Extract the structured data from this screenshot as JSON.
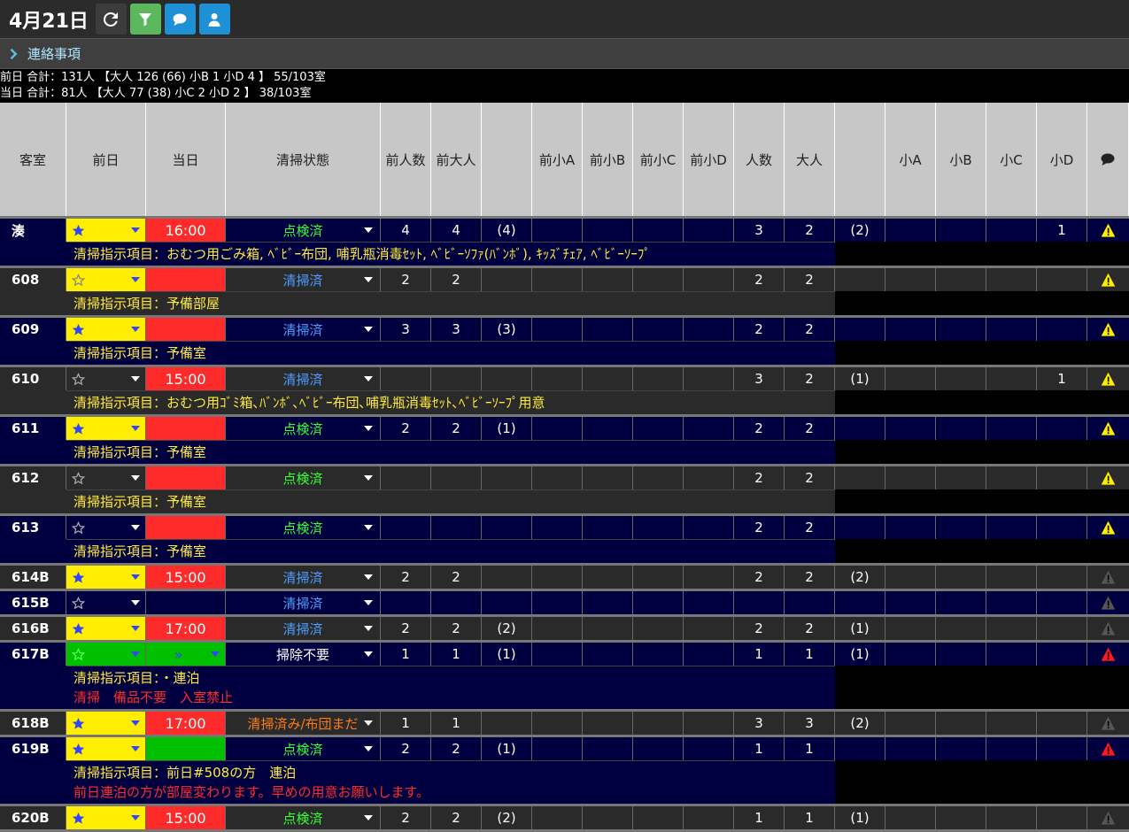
{
  "header": {
    "date": "4月21日",
    "buttons": [
      {
        "name": "refresh-button",
        "icon": "refresh-icon",
        "bg": "#3c3c3c"
      },
      {
        "name": "filter-button",
        "icon": "filter-icon",
        "bg": "#5cb85c"
      },
      {
        "name": "comment-button",
        "icon": "comment-icon",
        "bg": "#1e90d6"
      },
      {
        "name": "user-button",
        "icon": "user-icon",
        "bg": "#1e90d6"
      }
    ]
  },
  "notice": {
    "label": "連絡事項"
  },
  "summary": {
    "prev": "前日 合計：131人 【大人 126 (66) 小B 1 小D 4 】 55/103室",
    "today": "当日 合計：81人 【大人 77 (38) 小C 2 小D 2 】 38/103室"
  },
  "columns": [
    "客室",
    "前日",
    "当日",
    "清掃状態",
    "前人数",
    "前大人",
    "",
    "前小A",
    "前小B",
    "前小C",
    "前小D",
    "人数",
    "大人",
    "",
    "小A",
    "小B",
    "小C",
    "小D",
    "comment-icon"
  ],
  "colors": {
    "yellow": "#ffee00",
    "red": "#ff2a2a",
    "green": "#00c000",
    "rowBlue": "#000040",
    "rowGray": "#2a2a2a",
    "statusGreen": "#33ff33",
    "statusBlue": "#4d9cff",
    "statusOrange": "#ff7a1a",
    "warnYellow": "#ffee00",
    "warnRed": "#ff1a1a",
    "warnGray": "#555555"
  },
  "rows": [
    {
      "room": "湊",
      "bg": "blue",
      "star": "filled",
      "starBg": "yellow",
      "time": "16:00",
      "timeBg": "red",
      "status": "点検済",
      "statusColor": "statusGreen",
      "prevPeople": "4",
      "prevAdult": "4",
      "prevAdultSub": "(4)",
      "prevA": "",
      "prevB": "",
      "prevC": "",
      "prevD": "",
      "people": "3",
      "adult": "2",
      "adultSub": "(2)",
      "a": "",
      "b": "",
      "c": "",
      "d": "1",
      "warn": "yellow",
      "notes": [
        {
          "text": "清掃指示項目：おむつ用ごみ箱, ﾍﾞﾋﾞｰ布団, 哺乳瓶消毒ｾｯﾄ, ﾍﾞﾋﾞｰｿﾌｧ(ﾊﾞﾝﾎﾞ), ｷｯｽﾞﾁｪｱ, ﾍﾞﾋﾞｰｿｰﾌﾟ",
          "red": false
        }
      ]
    },
    {
      "room": "608",
      "bg": "gray",
      "star": "empty",
      "starBg": "yellow",
      "time": "",
      "timeBg": "red",
      "status": "清掃済",
      "statusColor": "statusBlue",
      "prevPeople": "2",
      "prevAdult": "2",
      "prevAdultSub": "",
      "prevA": "",
      "prevB": "",
      "prevC": "",
      "prevD": "",
      "people": "2",
      "adult": "2",
      "adultSub": "",
      "a": "",
      "b": "",
      "c": "",
      "d": "",
      "warn": "yellow",
      "notes": [
        {
          "text": "清掃指示項目：予備部屋",
          "red": false
        }
      ]
    },
    {
      "room": "609",
      "bg": "blue",
      "star": "filled",
      "starBg": "yellow",
      "time": "",
      "timeBg": "red",
      "status": "清掃済",
      "statusColor": "statusBlue",
      "prevPeople": "3",
      "prevAdult": "3",
      "prevAdultSub": "(3)",
      "prevA": "",
      "prevB": "",
      "prevC": "",
      "prevD": "",
      "people": "2",
      "adult": "2",
      "adultSub": "",
      "a": "",
      "b": "",
      "c": "",
      "d": "",
      "warn": "yellow",
      "notes": [
        {
          "text": "清掃指示項目：予備室",
          "red": false
        }
      ]
    },
    {
      "room": "610",
      "bg": "gray",
      "star": "empty",
      "starBg": "none",
      "time": "15:00",
      "timeBg": "red",
      "status": "清掃済",
      "statusColor": "statusBlue",
      "prevPeople": "",
      "prevAdult": "",
      "prevAdultSub": "",
      "prevA": "",
      "prevB": "",
      "prevC": "",
      "prevD": "",
      "people": "3",
      "adult": "2",
      "adultSub": "(1)",
      "a": "",
      "b": "",
      "c": "",
      "d": "1",
      "warn": "yellow",
      "notes": [
        {
          "text": "清掃指示項目：おむつ用ｺﾞﾐ箱､ﾊﾞﾝﾎﾞ､ﾍﾞﾋﾞｰ布団､哺乳瓶消毒ｾｯﾄ､ﾍﾞﾋﾞｰｿｰﾌﾟ用意",
          "red": false
        }
      ]
    },
    {
      "room": "611",
      "bg": "blue",
      "star": "filled",
      "starBg": "yellow",
      "time": "",
      "timeBg": "red",
      "status": "点検済",
      "statusColor": "statusGreen",
      "prevPeople": "2",
      "prevAdult": "2",
      "prevAdultSub": "(1)",
      "prevA": "",
      "prevB": "",
      "prevC": "",
      "prevD": "",
      "people": "2",
      "adult": "2",
      "adultSub": "",
      "a": "",
      "b": "",
      "c": "",
      "d": "",
      "warn": "yellow",
      "notes": [
        {
          "text": "清掃指示項目：予備室",
          "red": false
        }
      ]
    },
    {
      "room": "612",
      "bg": "gray",
      "star": "empty",
      "starBg": "none",
      "time": "",
      "timeBg": "red",
      "status": "点検済",
      "statusColor": "statusGreen",
      "prevPeople": "",
      "prevAdult": "",
      "prevAdultSub": "",
      "prevA": "",
      "prevB": "",
      "prevC": "",
      "prevD": "",
      "people": "2",
      "adult": "2",
      "adultSub": "",
      "a": "",
      "b": "",
      "c": "",
      "d": "",
      "warn": "yellow",
      "notes": [
        {
          "text": "清掃指示項目：予備室",
          "red": false
        }
      ]
    },
    {
      "room": "613",
      "bg": "blue",
      "star": "empty",
      "starBg": "none",
      "time": "",
      "timeBg": "red",
      "status": "点検済",
      "statusColor": "statusGreen",
      "prevPeople": "",
      "prevAdult": "",
      "prevAdultSub": "",
      "prevA": "",
      "prevB": "",
      "prevC": "",
      "prevD": "",
      "people": "2",
      "adult": "2",
      "adultSub": "",
      "a": "",
      "b": "",
      "c": "",
      "d": "",
      "warn": "yellow",
      "notes": [
        {
          "text": "清掃指示項目：予備室",
          "red": false
        }
      ]
    },
    {
      "room": "614B",
      "bg": "gray",
      "star": "filled",
      "starBg": "yellow",
      "time": "15:00",
      "timeBg": "red",
      "status": "清掃済",
      "statusColor": "statusBlue",
      "prevPeople": "2",
      "prevAdult": "2",
      "prevAdultSub": "",
      "prevA": "",
      "prevB": "",
      "prevC": "",
      "prevD": "",
      "people": "2",
      "adult": "2",
      "adultSub": "(2)",
      "a": "",
      "b": "",
      "c": "",
      "d": "",
      "warn": "gray",
      "notes": []
    },
    {
      "room": "615B",
      "bg": "blue",
      "star": "empty",
      "starBg": "none",
      "time": "",
      "timeBg": "none",
      "status": "清掃済",
      "statusColor": "statusBlue",
      "prevPeople": "",
      "prevAdult": "",
      "prevAdultSub": "",
      "prevA": "",
      "prevB": "",
      "prevC": "",
      "prevD": "",
      "people": "",
      "adult": "",
      "adultSub": "",
      "a": "",
      "b": "",
      "c": "",
      "d": "",
      "warn": "gray",
      "notes": []
    },
    {
      "room": "616B",
      "bg": "gray",
      "star": "filled",
      "starBg": "yellow",
      "time": "17:00",
      "timeBg": "red",
      "status": "清掃済",
      "statusColor": "statusBlue",
      "prevPeople": "2",
      "prevAdult": "2",
      "prevAdultSub": "(2)",
      "prevA": "",
      "prevB": "",
      "prevC": "",
      "prevD": "",
      "people": "2",
      "adult": "2",
      "adultSub": "(1)",
      "a": "",
      "b": "",
      "c": "",
      "d": "",
      "warn": "gray",
      "notes": []
    },
    {
      "room": "617B",
      "bg": "blue",
      "star": "empty-green",
      "starBg": "green",
      "time": "»",
      "timeBg": "green",
      "status": "掃除不要",
      "statusColor": "white",
      "prevPeople": "1",
      "prevAdult": "1",
      "prevAdultSub": "(1)",
      "prevA": "",
      "prevB": "",
      "prevC": "",
      "prevD": "",
      "people": "1",
      "adult": "1",
      "adultSub": "(1)",
      "a": "",
      "b": "",
      "c": "",
      "d": "",
      "warn": "red",
      "notes": [
        {
          "text": "清掃指示項目：・連泊",
          "red": false
        },
        {
          "text": "清掃　備品不要　入室禁止",
          "red": true
        }
      ]
    },
    {
      "room": "618B",
      "bg": "gray",
      "star": "filled",
      "starBg": "yellow",
      "time": "17:00",
      "timeBg": "red",
      "status": "清掃済み/布団まだ",
      "statusColor": "statusOrange",
      "prevPeople": "1",
      "prevAdult": "1",
      "prevAdultSub": "",
      "prevA": "",
      "prevB": "",
      "prevC": "",
      "prevD": "",
      "people": "3",
      "adult": "3",
      "adultSub": "(2)",
      "a": "",
      "b": "",
      "c": "",
      "d": "",
      "warn": "gray",
      "notes": []
    },
    {
      "room": "619B",
      "bg": "blue",
      "star": "filled",
      "starBg": "yellow",
      "time": "",
      "timeBg": "green",
      "status": "点検済",
      "statusColor": "statusGreen",
      "prevPeople": "2",
      "prevAdult": "2",
      "prevAdultSub": "(1)",
      "prevA": "",
      "prevB": "",
      "prevC": "",
      "prevD": "",
      "people": "1",
      "adult": "1",
      "adultSub": "",
      "a": "",
      "b": "",
      "c": "",
      "d": "",
      "warn": "red",
      "notes": [
        {
          "text": "清掃指示項目：前日#508の方　連泊",
          "red": false
        },
        {
          "text": "前日連泊の方が部屋変わります。早めの用意お願いします。",
          "red": true
        }
      ]
    },
    {
      "room": "620B",
      "bg": "gray",
      "star": "filled",
      "starBg": "yellow",
      "time": "15:00",
      "timeBg": "red",
      "status": "点検済",
      "statusColor": "statusGreen",
      "prevPeople": "2",
      "prevAdult": "2",
      "prevAdultSub": "(2)",
      "prevA": "",
      "prevB": "",
      "prevC": "",
      "prevD": "",
      "people": "1",
      "adult": "1",
      "adultSub": "(1)",
      "a": "",
      "b": "",
      "c": "",
      "d": "",
      "warn": "gray",
      "notes": []
    }
  ]
}
